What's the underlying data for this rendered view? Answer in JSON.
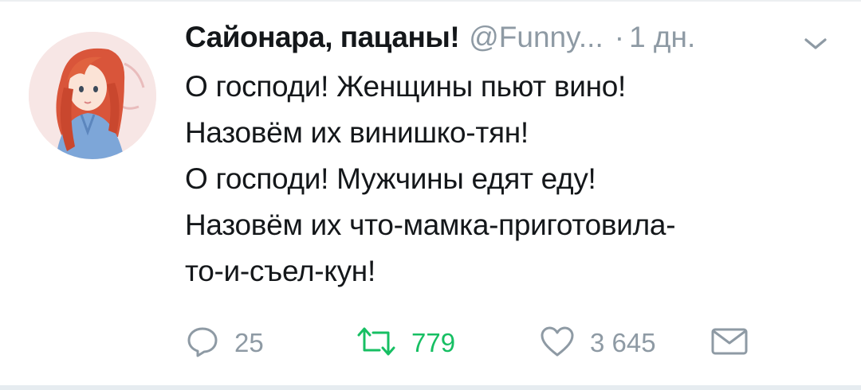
{
  "tweet": {
    "display_name": "Сайонара, пацаны!",
    "handle": "@Funny...",
    "separator": "·",
    "timestamp": "1 дн.",
    "lines": [
      "О господи! Женщины пьют вино!",
      "Назовём их винишко-тян!",
      "О господи! Мужчины едят еду!",
      "Назовём их что-мамка-приготовила-",
      "то-и-съел-кун!"
    ]
  },
  "actions": {
    "reply": {
      "icon": "reply-icon",
      "count": "25"
    },
    "retweet": {
      "icon": "retweet-icon",
      "count": "779"
    },
    "like": {
      "icon": "heart-icon",
      "count": "3 645"
    },
    "dm": {
      "icon": "envelope-icon"
    }
  },
  "colors": {
    "text": "#14171a",
    "muted": "#8e9aa4",
    "retweet_green": "#17bf63"
  }
}
